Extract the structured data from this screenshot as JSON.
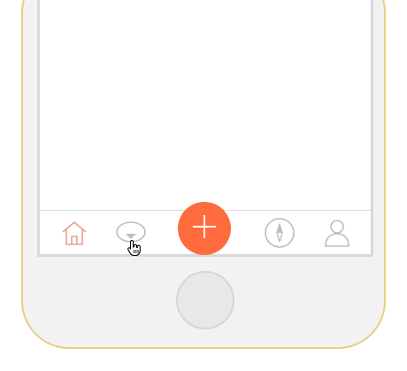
{
  "app": {
    "frame": "phone mockup",
    "accent_color": "#ff6b3d",
    "inactive_icon_color": "#bdbdbd",
    "active_icon_color": "#e8a08a",
    "frame_border_color": "#e6cf82"
  },
  "tabbar": {
    "items": [
      {
        "id": "home",
        "icon": "home-icon",
        "state": "active"
      },
      {
        "id": "messages",
        "icon": "chat-bubble-icon",
        "state": "inactive"
      },
      {
        "id": "add",
        "icon": "plus-icon",
        "state": "primary"
      },
      {
        "id": "discover",
        "icon": "compass-icon",
        "state": "inactive"
      },
      {
        "id": "profile",
        "icon": "user-icon",
        "state": "inactive"
      }
    ]
  },
  "device": {
    "home_button_icon": "home-button"
  },
  "cursor": {
    "icon": "hand-pointer-icon",
    "hovering": "messages"
  }
}
